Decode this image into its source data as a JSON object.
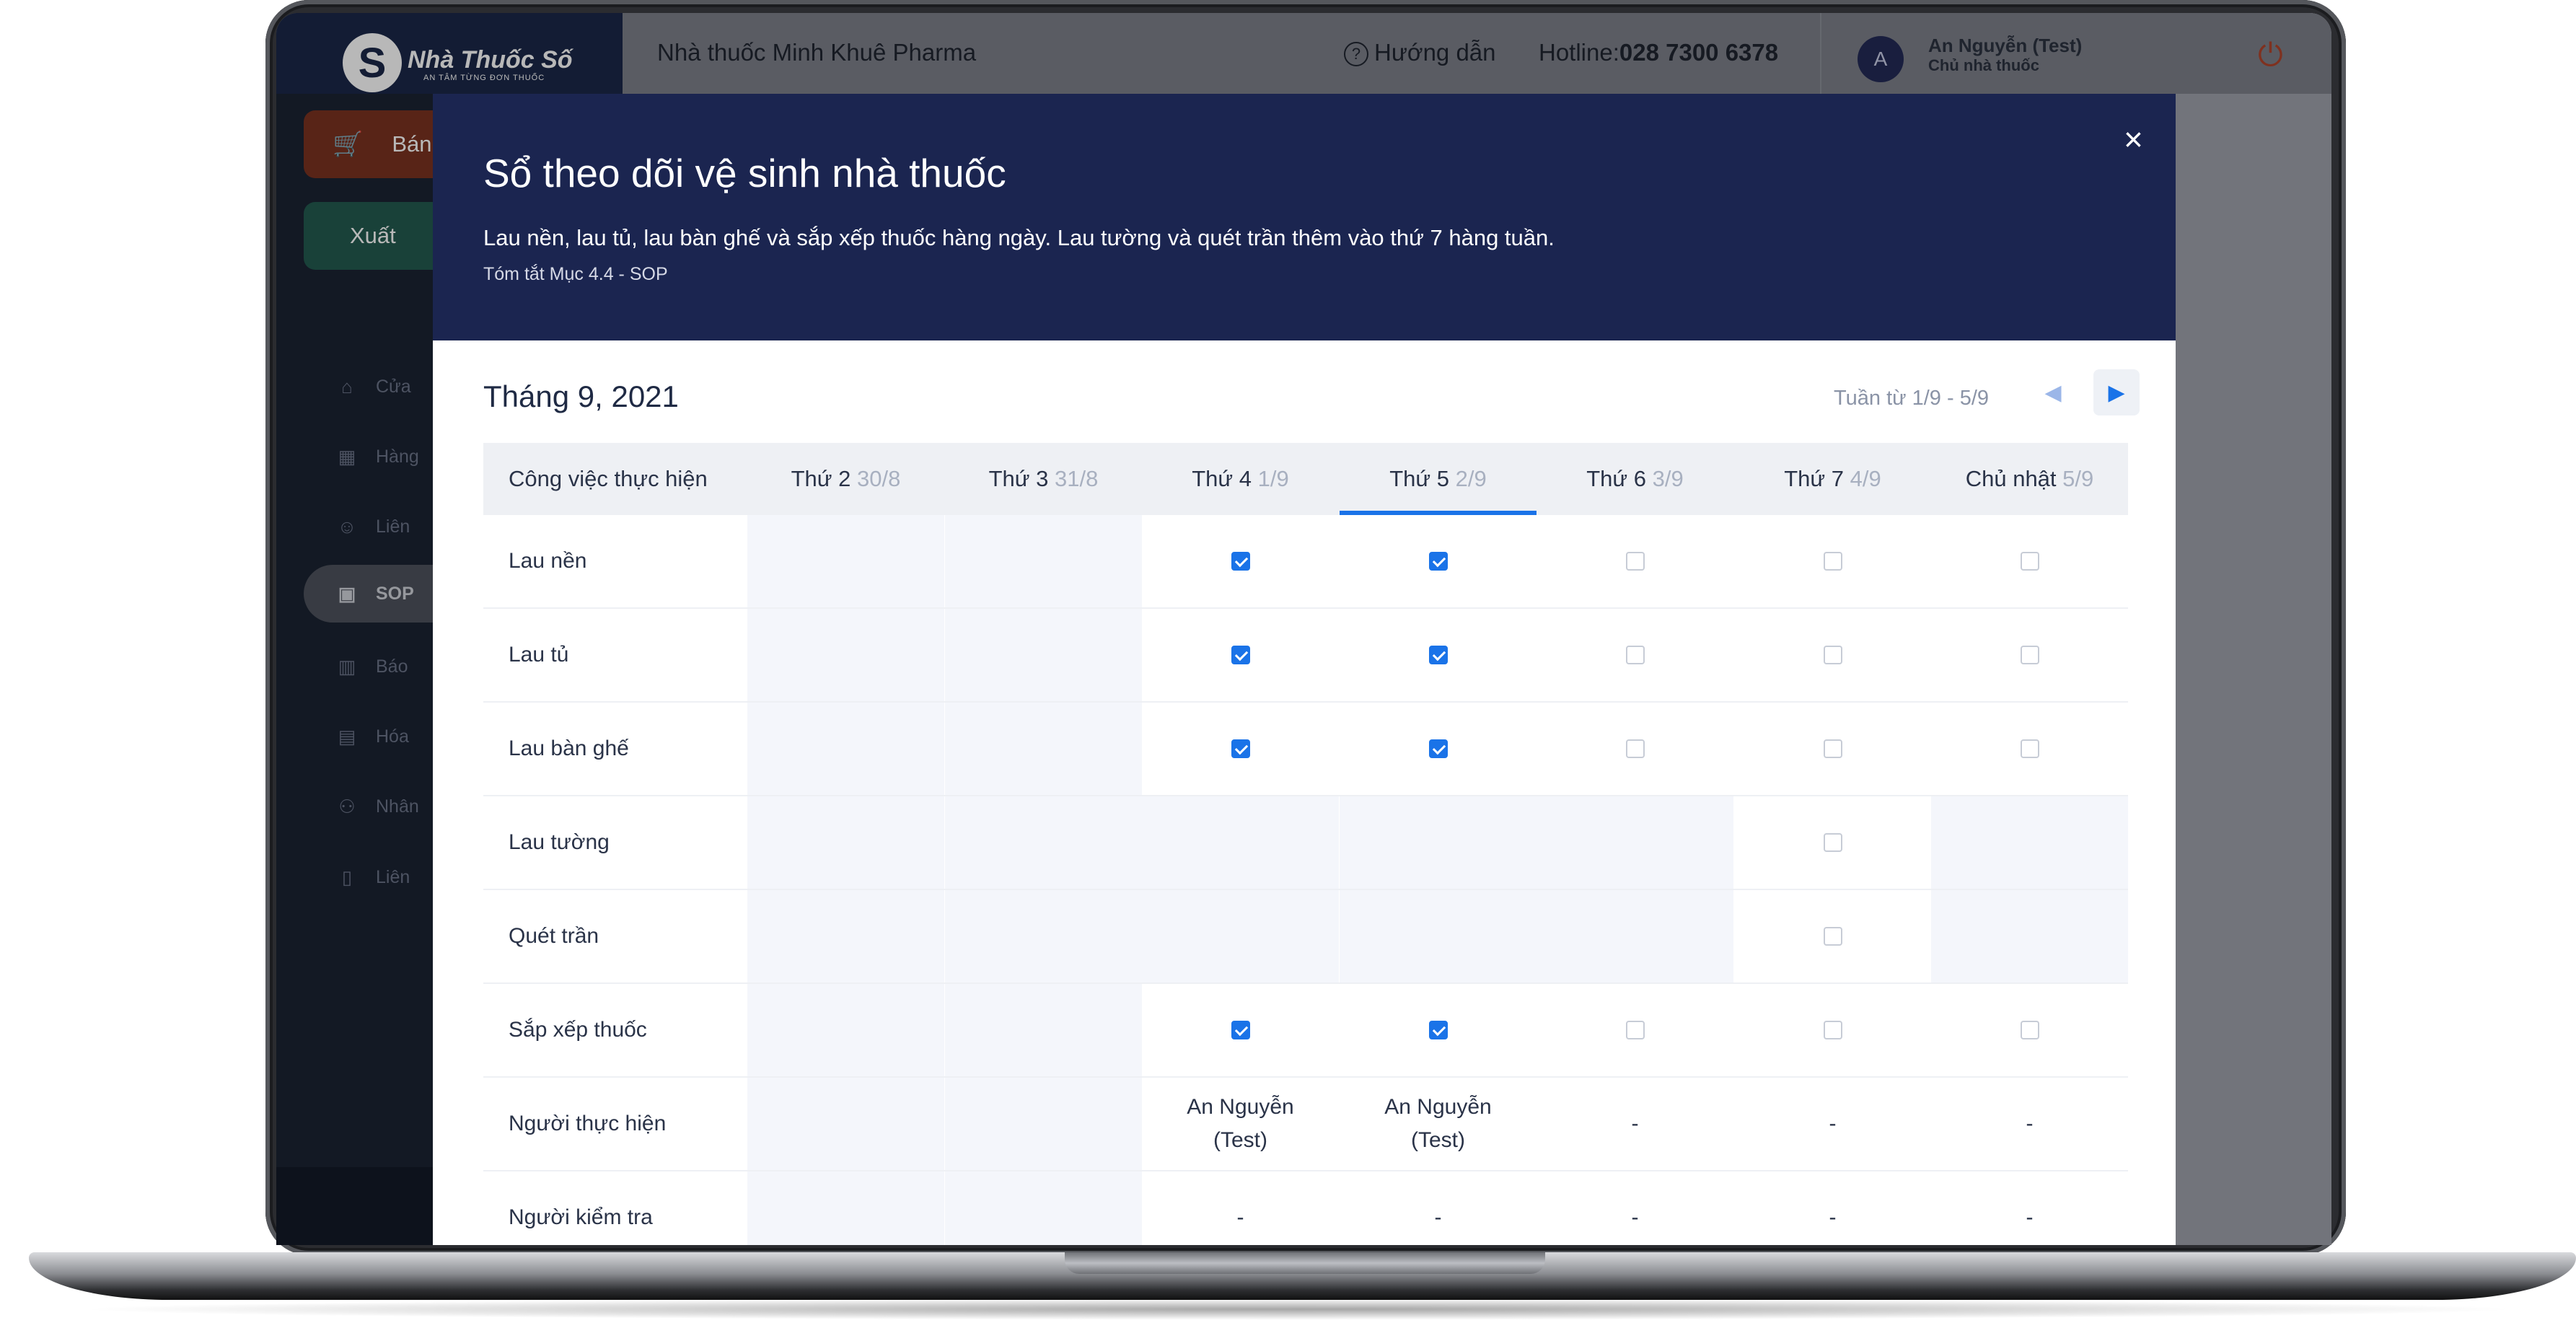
{
  "app": {
    "logo_text": "Nhà Thuốc Số",
    "logo_tagline": "AN TÂM TỪNG ĐƠN THUỐC",
    "pharmacy_name": "Nhà thuốc Minh Khuê Pharma",
    "help_label": "Hướng dẫn",
    "hotline_label": "Hotline:",
    "hotline_number": "028 7300 6378",
    "user": {
      "initial": "A",
      "name": "An Nguyễn (Test)",
      "role": "Chủ nhà thuốc"
    }
  },
  "sidebar": {
    "sell_label": "Bán",
    "export_label": "Xuất",
    "items": [
      {
        "label": "Cửa",
        "icon": "home-icon"
      },
      {
        "label": "Hàng",
        "icon": "boxes-icon"
      },
      {
        "label": "Liên",
        "icon": "contacts-icon"
      },
      {
        "label": "SOP",
        "icon": "sop-icon",
        "active": true
      },
      {
        "label": "Báo",
        "icon": "chart-icon"
      },
      {
        "label": "Hóa",
        "icon": "invoice-icon"
      },
      {
        "label": "Nhân",
        "icon": "staff-icon"
      },
      {
        "label": "Liên",
        "icon": "link-icon"
      }
    ]
  },
  "modal": {
    "title": "Sổ theo dõi vệ sinh nhà thuốc",
    "description": "Lau nền, lau tủ, lau bàn ghế và sắp xếp thuốc hàng ngày. Lau tường và quét trần thêm vào thứ 7 hàng tuần.",
    "subtitle": "Tóm tắt Mục 4.4 - SOP",
    "close_symbol": "×",
    "month": "Tháng 9, 2021",
    "week_range": "Tuần từ 1/9 - 5/9",
    "table": {
      "task_header": "Công việc thực hiện",
      "days": [
        {
          "name": "Thứ 2",
          "date": "30/8"
        },
        {
          "name": "Thứ 3",
          "date": "31/8"
        },
        {
          "name": "Thứ 4",
          "date": "1/9"
        },
        {
          "name": "Thứ 5",
          "date": "2/9",
          "today": true
        },
        {
          "name": "Thứ 6",
          "date": "3/9"
        },
        {
          "name": "Thứ 7",
          "date": "4/9"
        },
        {
          "name": "Chủ nhật",
          "date": "5/9"
        }
      ],
      "tasks": [
        {
          "label": "Lau nền",
          "cells": [
            null,
            null,
            true,
            true,
            false,
            false,
            false
          ]
        },
        {
          "label": "Lau tủ",
          "cells": [
            null,
            null,
            true,
            true,
            false,
            false,
            false
          ]
        },
        {
          "label": "Lau bàn ghế",
          "cells": [
            null,
            null,
            true,
            true,
            false,
            false,
            false
          ]
        },
        {
          "label": "Lau tường",
          "cells": [
            null,
            null,
            null,
            null,
            null,
            false,
            null
          ]
        },
        {
          "label": "Quét trần",
          "cells": [
            null,
            null,
            null,
            null,
            null,
            false,
            null
          ]
        },
        {
          "label": "Sắp xếp thuốc",
          "cells": [
            null,
            null,
            true,
            true,
            false,
            false,
            false
          ]
        }
      ],
      "performer_label": "Người thực hiện",
      "performer_values": [
        "",
        "",
        "An Nguyễn (Test)",
        "An Nguyễn (Test)",
        "-",
        "-",
        "-"
      ],
      "checker_label": "Người kiểm tra",
      "checker_values": [
        "",
        "",
        "-",
        "-",
        "-",
        "-",
        "-"
      ]
    }
  },
  "colors": {
    "modal_header": "#1b2550",
    "accent": "#1a73e8",
    "sell_button": "#c4491f",
    "export_button": "#2f8a76"
  }
}
